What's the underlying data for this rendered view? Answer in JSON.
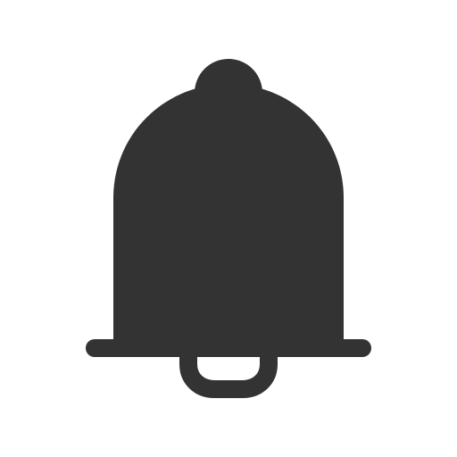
{
  "icon": {
    "name": "bell-icon",
    "color": "#333333",
    "background": "#ffffff"
  }
}
